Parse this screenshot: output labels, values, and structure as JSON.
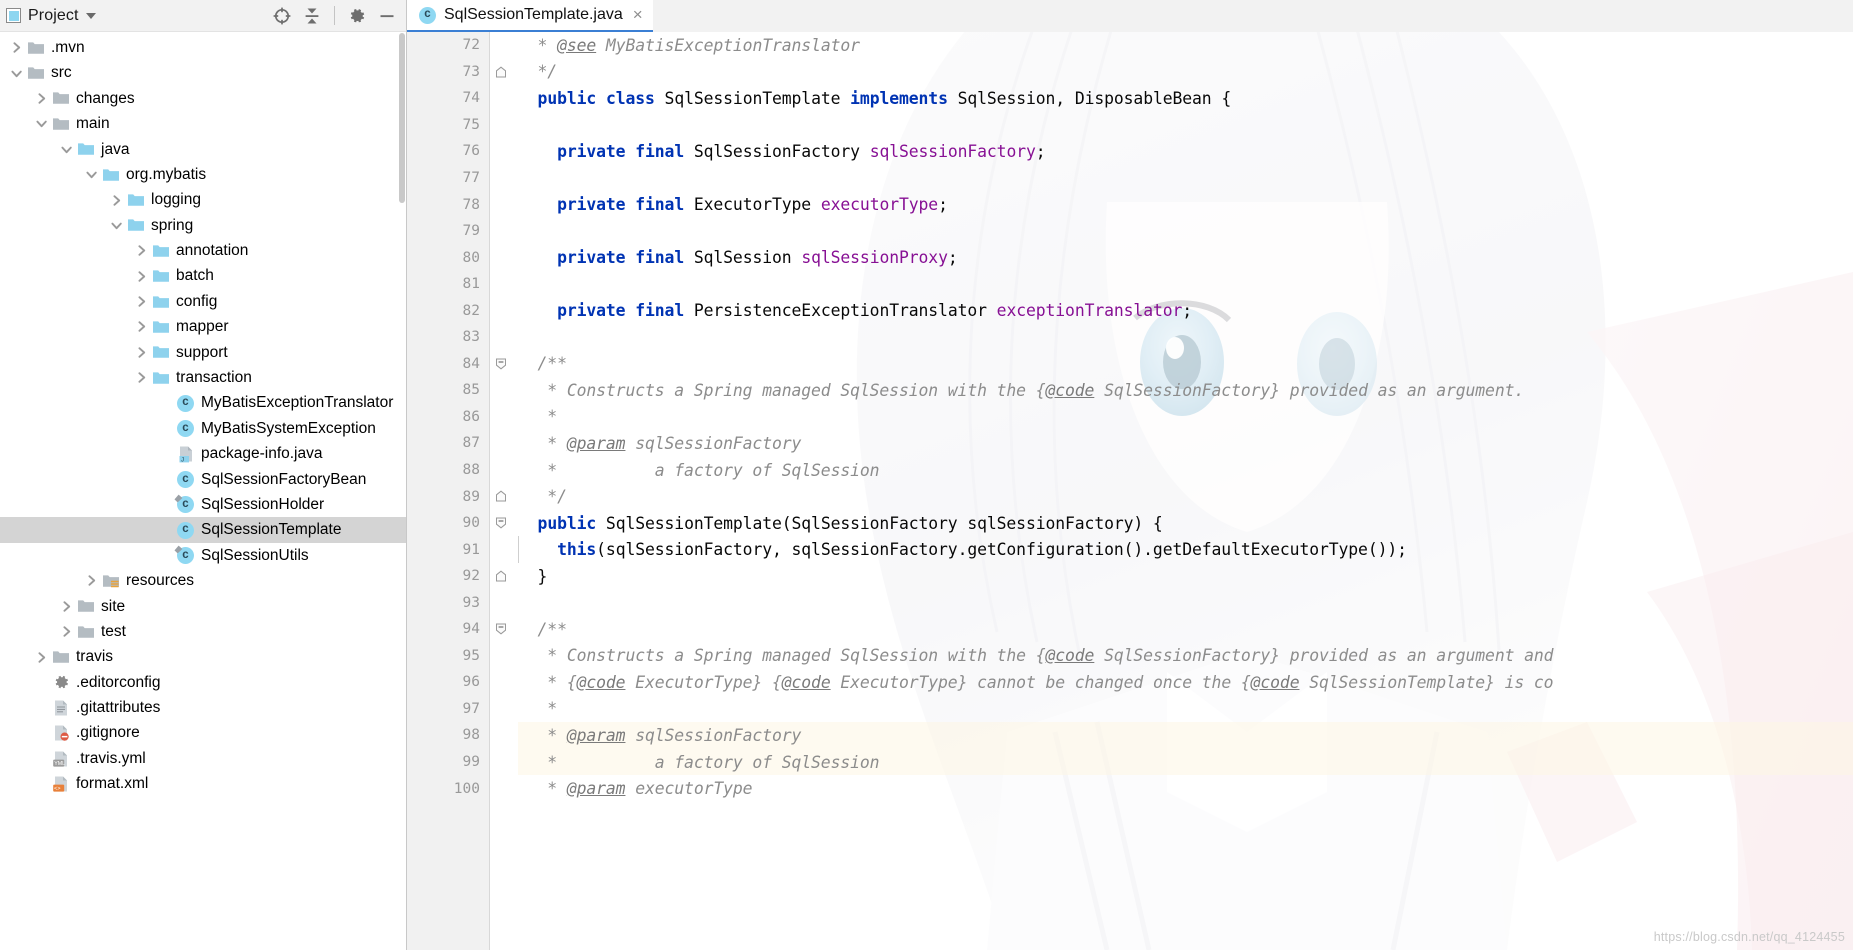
{
  "window": {
    "background_color": "#ffffff",
    "accent_color": "#3b7fd4"
  },
  "project_panel": {
    "title": "Project",
    "title_dropdown_icon": "chevron-down-icon",
    "panel_icon": "project-view-icon",
    "toolbar": [
      {
        "name": "select-opened-file-icon",
        "label": "Select Opened File"
      },
      {
        "name": "collapse-all-icon",
        "label": "Collapse All"
      },
      {
        "name": "gear-icon",
        "label": "Settings"
      },
      {
        "name": "minimize-icon",
        "label": "Hide"
      }
    ],
    "tree": [
      {
        "label": ".mvn",
        "indent": 0,
        "twisty": "collapsed",
        "icon": "folder-icon",
        "selected": false
      },
      {
        "label": "src",
        "indent": 0,
        "twisty": "expanded",
        "icon": "folder-icon",
        "selected": false
      },
      {
        "label": "changes",
        "indent": 1,
        "twisty": "collapsed",
        "icon": "folder-icon",
        "selected": false
      },
      {
        "label": "main",
        "indent": 1,
        "twisty": "expanded",
        "icon": "folder-icon",
        "selected": false
      },
      {
        "label": "java",
        "indent": 2,
        "twisty": "expanded",
        "icon": "source-folder-icon",
        "selected": false
      },
      {
        "label": "org.mybatis",
        "indent": 3,
        "twisty": "expanded",
        "icon": "package-icon",
        "selected": false
      },
      {
        "label": "logging",
        "indent": 4,
        "twisty": "collapsed",
        "icon": "package-icon",
        "selected": false
      },
      {
        "label": "spring",
        "indent": 4,
        "twisty": "expanded",
        "icon": "package-icon",
        "selected": false
      },
      {
        "label": "annotation",
        "indent": 5,
        "twisty": "collapsed",
        "icon": "package-icon",
        "selected": false
      },
      {
        "label": "batch",
        "indent": 5,
        "twisty": "collapsed",
        "icon": "package-icon",
        "selected": false
      },
      {
        "label": "config",
        "indent": 5,
        "twisty": "collapsed",
        "icon": "package-icon",
        "selected": false
      },
      {
        "label": "mapper",
        "indent": 5,
        "twisty": "collapsed",
        "icon": "package-icon",
        "selected": false
      },
      {
        "label": "support",
        "indent": 5,
        "twisty": "collapsed",
        "icon": "package-icon",
        "selected": false
      },
      {
        "label": "transaction",
        "indent": 5,
        "twisty": "collapsed",
        "icon": "package-icon",
        "selected": false
      },
      {
        "label": "MyBatisExceptionTranslator",
        "indent": 6,
        "twisty": "none",
        "icon": "java-class-icon",
        "selected": false
      },
      {
        "label": "MyBatisSystemException",
        "indent": 6,
        "twisty": "none",
        "icon": "java-class-icon",
        "selected": false
      },
      {
        "label": "package-info.java",
        "indent": 6,
        "twisty": "none",
        "icon": "java-file-icon",
        "selected": false
      },
      {
        "label": "SqlSessionFactoryBean",
        "indent": 6,
        "twisty": "none",
        "icon": "java-class-icon",
        "selected": false
      },
      {
        "label": "SqlSessionHolder",
        "indent": 6,
        "twisty": "none",
        "icon": "java-class-final-icon",
        "selected": false
      },
      {
        "label": "SqlSessionTemplate",
        "indent": 6,
        "twisty": "none",
        "icon": "java-class-icon",
        "selected": true
      },
      {
        "label": "SqlSessionUtils",
        "indent": 6,
        "twisty": "none",
        "icon": "java-class-final-icon",
        "selected": false
      },
      {
        "label": "resources",
        "indent": 3,
        "twisty": "collapsed",
        "icon": "resource-folder-icon",
        "selected": false
      },
      {
        "label": "site",
        "indent": 2,
        "twisty": "collapsed",
        "icon": "folder-icon",
        "selected": false
      },
      {
        "label": "test",
        "indent": 2,
        "twisty": "collapsed",
        "icon": "folder-icon",
        "selected": false
      },
      {
        "label": "travis",
        "indent": 1,
        "twisty": "collapsed",
        "icon": "folder-icon",
        "selected": false
      },
      {
        "label": ".editorconfig",
        "indent": 1,
        "twisty": "none",
        "icon": "editorconfig-icon",
        "selected": false
      },
      {
        "label": ".gitattributes",
        "indent": 1,
        "twisty": "none",
        "icon": "text-file-icon",
        "selected": false
      },
      {
        "label": ".gitignore",
        "indent": 1,
        "twisty": "none",
        "icon": "gitignore-icon",
        "selected": false
      },
      {
        "label": ".travis.yml",
        "indent": 1,
        "twisty": "none",
        "icon": "yml-file-icon",
        "selected": false
      },
      {
        "label": "format.xml",
        "indent": 1,
        "twisty": "none",
        "icon": "xml-file-icon",
        "selected": false
      }
    ]
  },
  "editor": {
    "tabs": [
      {
        "label": "SqlSessionTemplate.java",
        "icon": "java-class-icon",
        "active": true,
        "close_icon": "close-icon"
      }
    ],
    "first_line_number": 72,
    "lines": [
      {
        "n": 72,
        "fold": "none",
        "highlight": false,
        "tokens": [
          {
            "t": "  * ",
            "c": "cmt"
          },
          {
            "t": "@see",
            "c": "tag"
          },
          {
            "t": " MyBatisExceptionTranslator",
            "c": "cmt"
          }
        ]
      },
      {
        "n": 73,
        "fold": "end",
        "highlight": false,
        "tokens": [
          {
            "t": "  */",
            "c": "cmt"
          }
        ]
      },
      {
        "n": 74,
        "fold": "none",
        "highlight": false,
        "tokens": [
          {
            "t": "  ",
            "c": "pln"
          },
          {
            "t": "public",
            "c": "kw"
          },
          {
            "t": " ",
            "c": "pln"
          },
          {
            "t": "class",
            "c": "kw"
          },
          {
            "t": " SqlSessionTemplate ",
            "c": "pln"
          },
          {
            "t": "implements",
            "c": "kw"
          },
          {
            "t": " SqlSession, DisposableBean {",
            "c": "pln"
          }
        ]
      },
      {
        "n": 75,
        "fold": "none",
        "highlight": false,
        "tokens": []
      },
      {
        "n": 76,
        "fold": "none",
        "highlight": false,
        "tokens": [
          {
            "t": "    ",
            "c": "pln"
          },
          {
            "t": "private",
            "c": "kw"
          },
          {
            "t": " ",
            "c": "pln"
          },
          {
            "t": "final",
            "c": "kw"
          },
          {
            "t": " SqlSessionFactory ",
            "c": "pln"
          },
          {
            "t": "sqlSessionFactory",
            "c": "fld"
          },
          {
            "t": ";",
            "c": "pln"
          }
        ]
      },
      {
        "n": 77,
        "fold": "none",
        "highlight": false,
        "tokens": []
      },
      {
        "n": 78,
        "fold": "none",
        "highlight": false,
        "tokens": [
          {
            "t": "    ",
            "c": "pln"
          },
          {
            "t": "private",
            "c": "kw"
          },
          {
            "t": " ",
            "c": "pln"
          },
          {
            "t": "final",
            "c": "kw"
          },
          {
            "t": " ExecutorType ",
            "c": "pln"
          },
          {
            "t": "executorType",
            "c": "fld"
          },
          {
            "t": ";",
            "c": "pln"
          }
        ]
      },
      {
        "n": 79,
        "fold": "none",
        "highlight": false,
        "tokens": []
      },
      {
        "n": 80,
        "fold": "none",
        "highlight": false,
        "tokens": [
          {
            "t": "    ",
            "c": "pln"
          },
          {
            "t": "private",
            "c": "kw"
          },
          {
            "t": " ",
            "c": "pln"
          },
          {
            "t": "final",
            "c": "kw"
          },
          {
            "t": " SqlSession ",
            "c": "pln"
          },
          {
            "t": "sqlSessionProxy",
            "c": "fld"
          },
          {
            "t": ";",
            "c": "pln"
          }
        ]
      },
      {
        "n": 81,
        "fold": "none",
        "highlight": false,
        "tokens": []
      },
      {
        "n": 82,
        "fold": "none",
        "highlight": false,
        "tokens": [
          {
            "t": "    ",
            "c": "pln"
          },
          {
            "t": "private",
            "c": "kw"
          },
          {
            "t": " ",
            "c": "pln"
          },
          {
            "t": "final",
            "c": "kw"
          },
          {
            "t": " PersistenceExceptionTranslator ",
            "c": "pln"
          },
          {
            "t": "exceptionTranslator",
            "c": "fld"
          },
          {
            "t": ";",
            "c": "pln"
          }
        ]
      },
      {
        "n": 83,
        "fold": "none",
        "highlight": false,
        "tokens": []
      },
      {
        "n": 84,
        "fold": "start",
        "highlight": false,
        "tokens": [
          {
            "t": "  /**",
            "c": "cmt"
          }
        ]
      },
      {
        "n": 85,
        "fold": "none",
        "highlight": false,
        "tokens": [
          {
            "t": "   * Constructs a Spring managed SqlSession with the {",
            "c": "cmt"
          },
          {
            "t": "@code",
            "c": "tag"
          },
          {
            "t": " SqlSessionFactory} provided as an argument.",
            "c": "cmt"
          }
        ]
      },
      {
        "n": 86,
        "fold": "none",
        "highlight": false,
        "tokens": [
          {
            "t": "   *",
            "c": "cmt"
          }
        ]
      },
      {
        "n": 87,
        "fold": "none",
        "highlight": false,
        "tokens": [
          {
            "t": "   * ",
            "c": "cmt"
          },
          {
            "t": "@param",
            "c": "tag"
          },
          {
            "t": " sqlSessionFactory",
            "c": "cmt"
          }
        ]
      },
      {
        "n": 88,
        "fold": "none",
        "highlight": false,
        "tokens": [
          {
            "t": "   *          a factory of SqlSession",
            "c": "cmt"
          }
        ]
      },
      {
        "n": 89,
        "fold": "end",
        "highlight": false,
        "tokens": [
          {
            "t": "   */",
            "c": "cmt"
          }
        ]
      },
      {
        "n": 90,
        "fold": "start",
        "highlight": false,
        "tokens": [
          {
            "t": "  ",
            "c": "pln"
          },
          {
            "t": "public",
            "c": "kw"
          },
          {
            "t": " SqlSessionTemplate(SqlSessionFactory sqlSessionFactory) {",
            "c": "pln"
          }
        ]
      },
      {
        "n": 91,
        "fold": "none",
        "highlight": false,
        "tokens": [
          {
            "t": "    ",
            "c": "pln"
          },
          {
            "t": "this",
            "c": "kw"
          },
          {
            "t": "(sqlSessionFactory, sqlSessionFactory.getConfiguration().getDefaultExecutorType());",
            "c": "pln"
          }
        ]
      },
      {
        "n": 92,
        "fold": "end",
        "highlight": false,
        "tokens": [
          {
            "t": "  }",
            "c": "pln"
          }
        ]
      },
      {
        "n": 93,
        "fold": "none",
        "highlight": false,
        "tokens": []
      },
      {
        "n": 94,
        "fold": "start",
        "highlight": false,
        "tokens": [
          {
            "t": "  /**",
            "c": "cmt"
          }
        ]
      },
      {
        "n": 95,
        "fold": "none",
        "highlight": false,
        "tokens": [
          {
            "t": "   * Constructs a Spring managed SqlSession with the {",
            "c": "cmt"
          },
          {
            "t": "@code",
            "c": "tag"
          },
          {
            "t": " SqlSessionFactory} provided as an argument and",
            "c": "cmt"
          }
        ]
      },
      {
        "n": 96,
        "fold": "none",
        "highlight": false,
        "tokens": [
          {
            "t": "   * {",
            "c": "cmt"
          },
          {
            "t": "@code",
            "c": "tag"
          },
          {
            "t": " ExecutorType} {",
            "c": "cmt"
          },
          {
            "t": "@code",
            "c": "tag"
          },
          {
            "t": " ExecutorType} cannot be changed once the {",
            "c": "cmt"
          },
          {
            "t": "@code",
            "c": "tag"
          },
          {
            "t": " SqlSessionTemplate} is co",
            "c": "cmt"
          }
        ]
      },
      {
        "n": 97,
        "fold": "none",
        "highlight": false,
        "tokens": [
          {
            "t": "   *",
            "c": "cmt"
          }
        ]
      },
      {
        "n": 98,
        "fold": "none",
        "highlight": true,
        "tokens": [
          {
            "t": "   * ",
            "c": "cmt"
          },
          {
            "t": "@param",
            "c": "tag"
          },
          {
            "t": " sqlSessionFactory",
            "c": "cmt"
          }
        ]
      },
      {
        "n": 99,
        "fold": "none",
        "highlight": true,
        "tokens": [
          {
            "t": "   *          a factory of SqlSession",
            "c": "cmt"
          }
        ]
      },
      {
        "n": 100,
        "fold": "none",
        "highlight": false,
        "tokens": [
          {
            "t": "   * ",
            "c": "cmt"
          },
          {
            "t": "@param",
            "c": "tag"
          },
          {
            "t": " executorType",
            "c": "cmt"
          }
        ]
      }
    ]
  },
  "watermark": {
    "text": "https://blog.csdn.net/qq_4124455"
  }
}
